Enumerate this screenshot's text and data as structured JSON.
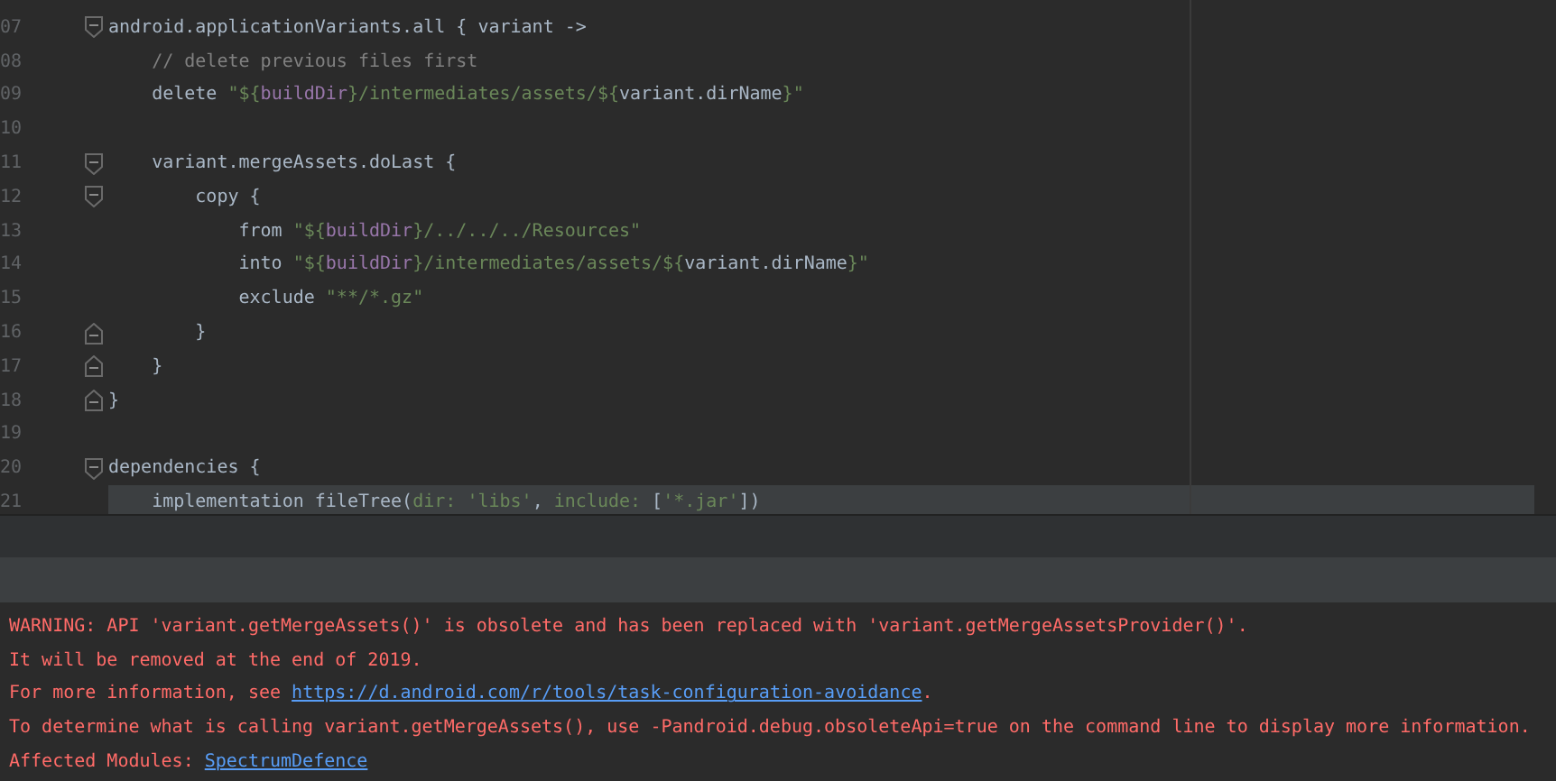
{
  "editor": {
    "lines": [
      {
        "number": "07",
        "fold_open": true,
        "current": false,
        "tokens": [
          {
            "kind": "plain",
            "text": "android.applicationVariants.all { variant ->"
          }
        ]
      },
      {
        "number": "08",
        "current": false,
        "tokens": [
          {
            "kind": "comment",
            "text": "    // delete previous files first"
          }
        ]
      },
      {
        "number": "09",
        "current": false,
        "tokens": [
          {
            "kind": "plain",
            "text": "    delete "
          },
          {
            "kind": "string",
            "text": "\"${"
          },
          {
            "kind": "interp",
            "text": "buildDir"
          },
          {
            "kind": "string",
            "text": "}/intermediates/assets/${"
          },
          {
            "kind": "plain",
            "text": "variant.dirName"
          },
          {
            "kind": "string",
            "text": "}\""
          }
        ]
      },
      {
        "number": "10",
        "current": false
      },
      {
        "number": "11",
        "fold_open": true,
        "current": false,
        "tokens": [
          {
            "kind": "plain",
            "text": "    variant.mergeAssets.doLast {"
          }
        ]
      },
      {
        "number": "12",
        "fold_open": true,
        "current": false,
        "tokens": [
          {
            "kind": "plain",
            "text": "        copy {"
          }
        ]
      },
      {
        "number": "13",
        "current": false,
        "tokens": [
          {
            "kind": "plain",
            "text": "            from "
          },
          {
            "kind": "string",
            "text": "\"${"
          },
          {
            "kind": "interp",
            "text": "buildDir"
          },
          {
            "kind": "string",
            "text": "}/../../../Resources\""
          }
        ]
      },
      {
        "number": "14",
        "current": false,
        "tokens": [
          {
            "kind": "plain",
            "text": "            into "
          },
          {
            "kind": "string",
            "text": "\"${"
          },
          {
            "kind": "interp",
            "text": "buildDir"
          },
          {
            "kind": "string",
            "text": "}/intermediates/assets/${"
          },
          {
            "kind": "plain",
            "text": "variant.dirName"
          },
          {
            "kind": "string",
            "text": "}\""
          }
        ]
      },
      {
        "number": "15",
        "current": false,
        "tokens": [
          {
            "kind": "plain",
            "text": "            exclude "
          },
          {
            "kind": "string",
            "text": "\"**/*.gz\""
          }
        ]
      },
      {
        "number": "16",
        "fold_close": true,
        "current": false,
        "tokens": [
          {
            "kind": "plain",
            "text": "        }"
          }
        ]
      },
      {
        "number": "17",
        "fold_close": true,
        "current": false,
        "tokens": [
          {
            "kind": "plain",
            "text": "    }"
          }
        ]
      },
      {
        "number": "18",
        "fold_close": true,
        "current": false,
        "tokens": [
          {
            "kind": "plain",
            "text": "}"
          }
        ]
      },
      {
        "number": "19",
        "current": false
      },
      {
        "number": "20",
        "fold_open": true,
        "current": false,
        "tokens": [
          {
            "kind": "plain",
            "text": "dependencies {"
          }
        ]
      },
      {
        "number": "21",
        "current": true,
        "tokens": [
          {
            "kind": "plain",
            "text": "    implementation fileTree("
          },
          {
            "kind": "string",
            "text": "dir: "
          },
          {
            "kind": "string",
            "text": "'libs'"
          },
          {
            "kind": "plain",
            "text": ", "
          },
          {
            "kind": "string",
            "text": "include: "
          },
          {
            "kind": "plain",
            "text": "["
          },
          {
            "kind": "string",
            "text": "'*.jar'"
          },
          {
            "kind": "plain",
            "text": "])"
          }
        ]
      }
    ]
  },
  "console": {
    "lines": [
      [
        {
          "kind": "plain",
          "text": "WARNING: API 'variant.getMergeAssets()' is obsolete and has been replaced with 'variant.getMergeAssetsProvider()'."
        }
      ],
      [
        {
          "kind": "plain",
          "text": "It will be removed at the end of 2019."
        }
      ],
      [
        {
          "kind": "plain",
          "text": "For more information, see "
        },
        {
          "kind": "link",
          "text": "https://d.android.com/r/tools/task-configuration-avoidance"
        },
        {
          "kind": "plain",
          "text": "."
        }
      ],
      [
        {
          "kind": "plain",
          "text": "To determine what is calling variant.getMergeAssets(), use -Pandroid.debug.obsoleteApi=true on the command line to display more information."
        }
      ],
      [
        {
          "kind": "label",
          "text": "Affected Modules: "
        },
        {
          "kind": "link",
          "text": "SpectrumDefence"
        }
      ]
    ]
  }
}
